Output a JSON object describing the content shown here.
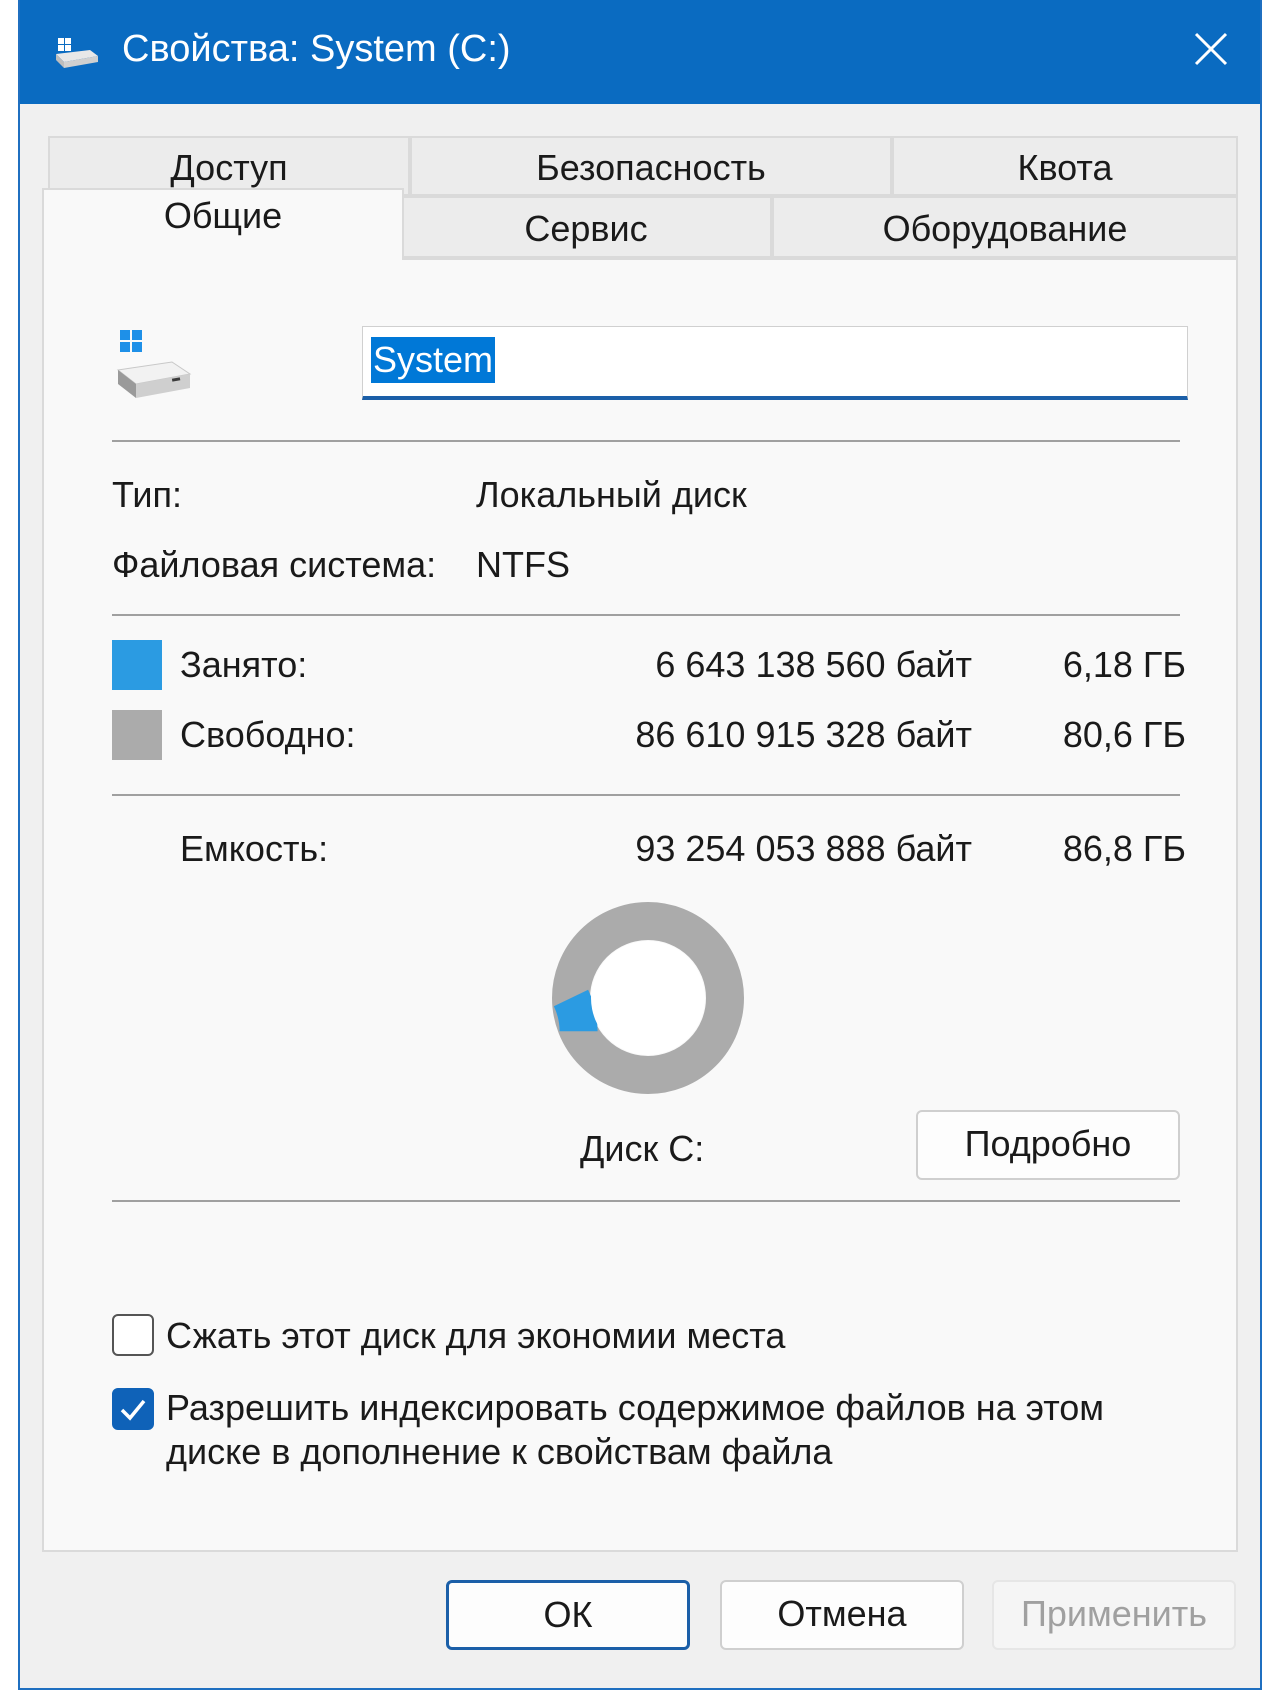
{
  "window": {
    "title": "Свойства: System (C:)"
  },
  "tabs": {
    "row1": [
      "Доступ",
      "Безопасность",
      "Квота"
    ],
    "row2": [
      "Общие",
      "Сервис",
      "Оборудование"
    ],
    "active": "Общие"
  },
  "general": {
    "name_value": "System",
    "type_label": "Тип:",
    "type_value": "Локальный диск",
    "fs_label": "Файловая система:",
    "fs_value": "NTFS",
    "used": {
      "label": "Занято:",
      "bytes": "6 643 138 560 байт",
      "size": "6,18 ГБ",
      "color": "#2b9be2"
    },
    "free": {
      "label": "Свободно:",
      "bytes": "86 610 915 328 байт",
      "size": "80,6 ГБ",
      "color": "#ababab"
    },
    "capacity": {
      "label": "Емкость:",
      "bytes": "93 254 053 888 байт",
      "size": "86,8 ГБ"
    },
    "disk_label": "Диск C:",
    "details_button": "Подробно",
    "used_fraction": 0.0712
  },
  "options": {
    "compress": {
      "label": "Сжать этот диск для экономии места",
      "checked": false
    },
    "index": {
      "label_line1": "Разрешить индексировать содержимое файлов на этом",
      "label_line2": "диске в дополнение к свойствам файла",
      "checked": true
    }
  },
  "buttons": {
    "ok": "ОК",
    "cancel": "Отмена",
    "apply": "Применить"
  },
  "icons": [
    "drive-icon",
    "close-icon",
    "checkmark-icon"
  ]
}
